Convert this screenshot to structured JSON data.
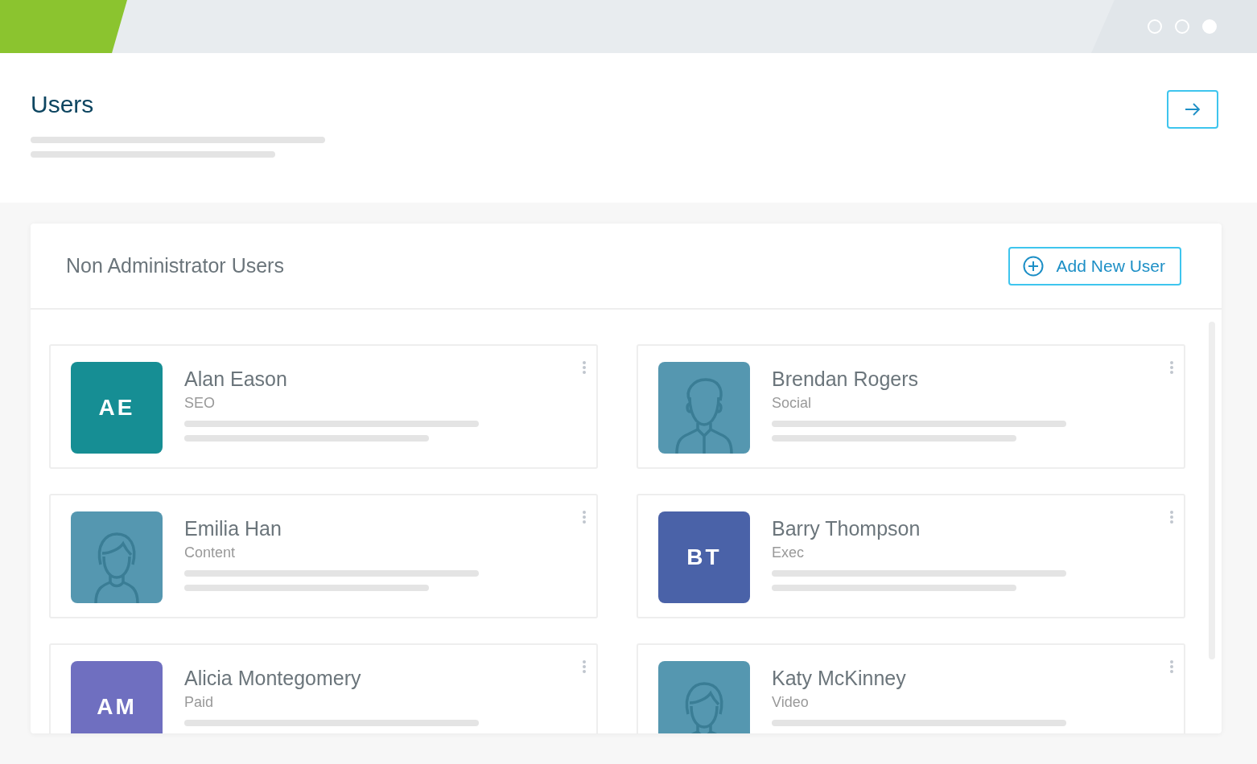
{
  "window": {
    "dots": [
      {
        "filled": false
      },
      {
        "filled": false
      },
      {
        "filled": true
      }
    ]
  },
  "page": {
    "title": "Users"
  },
  "panel": {
    "title": "Non Administrator Users",
    "add_button": "Add New User"
  },
  "users": [
    {
      "name": "Alan Eason",
      "role": "SEO",
      "avatar": {
        "kind": "initials",
        "text": "AE",
        "color": "#168e94"
      }
    },
    {
      "name": "Brendan Rogers",
      "role": "Social",
      "avatar": {
        "kind": "male",
        "color": "#5597b0"
      }
    },
    {
      "name": "Emilia Han",
      "role": "Content",
      "avatar": {
        "kind": "female",
        "color": "#5597b0"
      }
    },
    {
      "name": "Barry Thompson",
      "role": "Exec",
      "avatar": {
        "kind": "initials",
        "text": "BT",
        "color": "#4a62a8"
      }
    },
    {
      "name": "Alicia Montegomery",
      "role": "Paid",
      "avatar": {
        "kind": "initials",
        "text": "AM",
        "color": "#6f6fc0"
      }
    },
    {
      "name": "Katy McKinney",
      "role": "Video",
      "avatar": {
        "kind": "female",
        "color": "#5597b0"
      }
    }
  ]
}
